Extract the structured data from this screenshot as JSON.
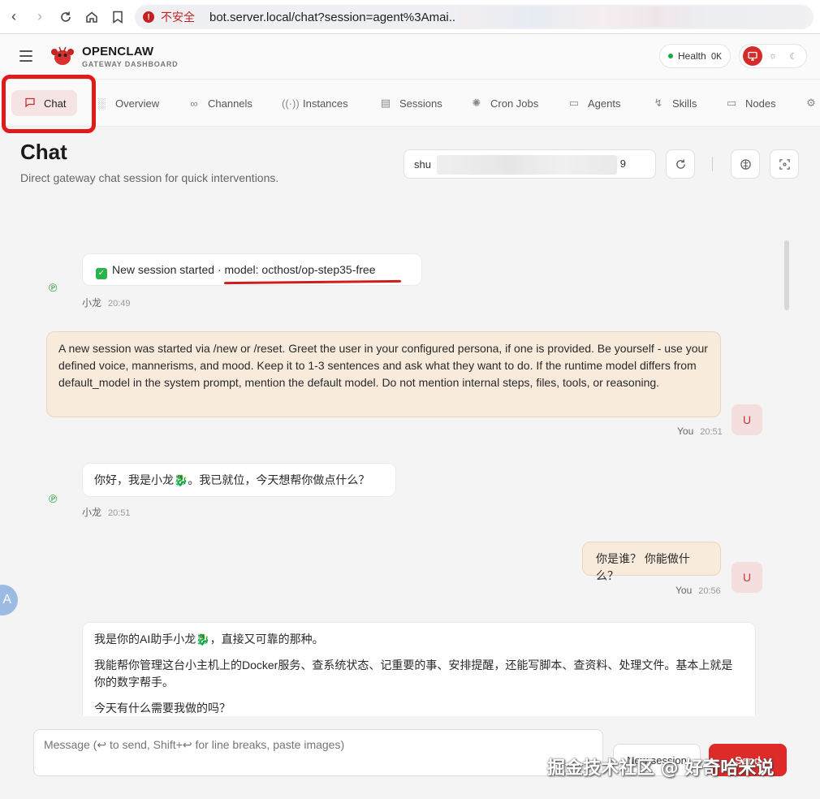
{
  "browser": {
    "insecure_label": "不安全",
    "url": "bot.server.local/chat?session=agent%3Amai.."
  },
  "app": {
    "brand": "OPENCLAW",
    "subtitle": "GATEWAY DASHBOARD",
    "health_label": "Health",
    "health_value": "OK"
  },
  "tabs": [
    {
      "label": "Chat",
      "icon": "chat-icon",
      "active": true
    },
    {
      "label": "Overview",
      "icon": "bar-chart-icon"
    },
    {
      "label": "Channels",
      "icon": "link-icon"
    },
    {
      "label": "Instances",
      "icon": "radio-icon"
    },
    {
      "label": "Sessions",
      "icon": "document-icon"
    },
    {
      "label": "Cron Jobs",
      "icon": "loader-icon"
    },
    {
      "label": "Agents",
      "icon": "folder-icon"
    },
    {
      "label": "Skills",
      "icon": "bolt-icon"
    },
    {
      "label": "Nodes",
      "icon": "monitor-icon"
    }
  ],
  "page": {
    "title": "Chat",
    "subtitle": "Direct gateway chat session for quick interventions.",
    "session_prefix": "shu",
    "session_suffix": "9"
  },
  "messages": [
    {
      "role": "bot",
      "text": "New session started · model: octhost/op-step35-free",
      "sender": "小龙",
      "time": "20:49"
    },
    {
      "role": "user",
      "text": "A new session was started via /new or /reset. Greet the user in your configured persona, if one is provided. Be yourself - use your defined voice, mannerisms, and mood. Keep it to 1-3 sentences and ask what they want to do. If the runtime model differs from default_model in the system prompt, mention the default model. Do not mention internal steps, files, tools, or reasoning.",
      "sender": "You",
      "time": "20:51",
      "avatar": "U"
    },
    {
      "role": "bot",
      "text": "你好，我是小龙🐉。我已就位，今天想帮你做点什么？",
      "sender": "小龙",
      "time": "20:51"
    },
    {
      "role": "user",
      "text": "你是谁？ 你能做什么？",
      "sender": "You",
      "time": "20:56",
      "avatar": "U"
    },
    {
      "role": "bot",
      "paragraphs": [
        "我是你的AI助手小龙🐉，直接又可靠的那种。",
        "我能帮你管理这台小主机上的Docker服务、查系统状态、记重要的事、安排提醒，还能写脚本、查资料、处理文件。基本上就是你的数字帮手。",
        "今天有什么需要我做的吗？"
      ]
    }
  ],
  "composer": {
    "placeholder": "Message (↩ to send, Shift+↩ for line breaks, paste images)",
    "new_session_label": "New session",
    "send_label": "Send"
  },
  "watermark": "掘金技术社区 @ 好奇哈米说",
  "colors": {
    "accent": "#df2a2a",
    "user_bubble": "#f8ebdc",
    "health_ok": "#1aa84c"
  }
}
